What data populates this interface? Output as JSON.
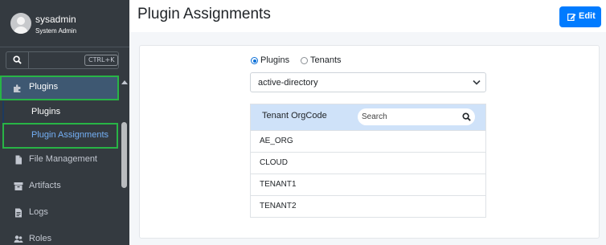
{
  "user": {
    "name": "sysadmin",
    "role": "System Admin"
  },
  "sidebar": {
    "search_shortcut": "CTRL+K",
    "items": [
      {
        "label": "Plugins",
        "icon": "puzzle-icon"
      },
      {
        "label": "Plugins"
      },
      {
        "label": "Plugin Assignments"
      },
      {
        "label": "File Management",
        "icon": "file-icon"
      },
      {
        "label": "Artifacts",
        "icon": "archive-icon"
      },
      {
        "label": "Logs",
        "icon": "log-file-icon"
      },
      {
        "label": "Roles",
        "icon": "users-icon"
      }
    ]
  },
  "header": {
    "title": "Plugin Assignments",
    "edit_label": "Edit"
  },
  "form": {
    "radio_options": [
      {
        "label": "Plugins",
        "checked": true
      },
      {
        "label": "Tenants",
        "checked": false
      }
    ],
    "plugin_select": "active-directory"
  },
  "table": {
    "column_header": "Tenant OrgCode",
    "search_placeholder": "Search",
    "rows": [
      "AE_ORG",
      "CLOUD",
      "TENANT1",
      "TENANT2"
    ]
  },
  "colors": {
    "sidebar_bg": "#343a40",
    "highlight": "#28b446",
    "primary": "#007bff",
    "table_header": "#cfe2f9"
  }
}
